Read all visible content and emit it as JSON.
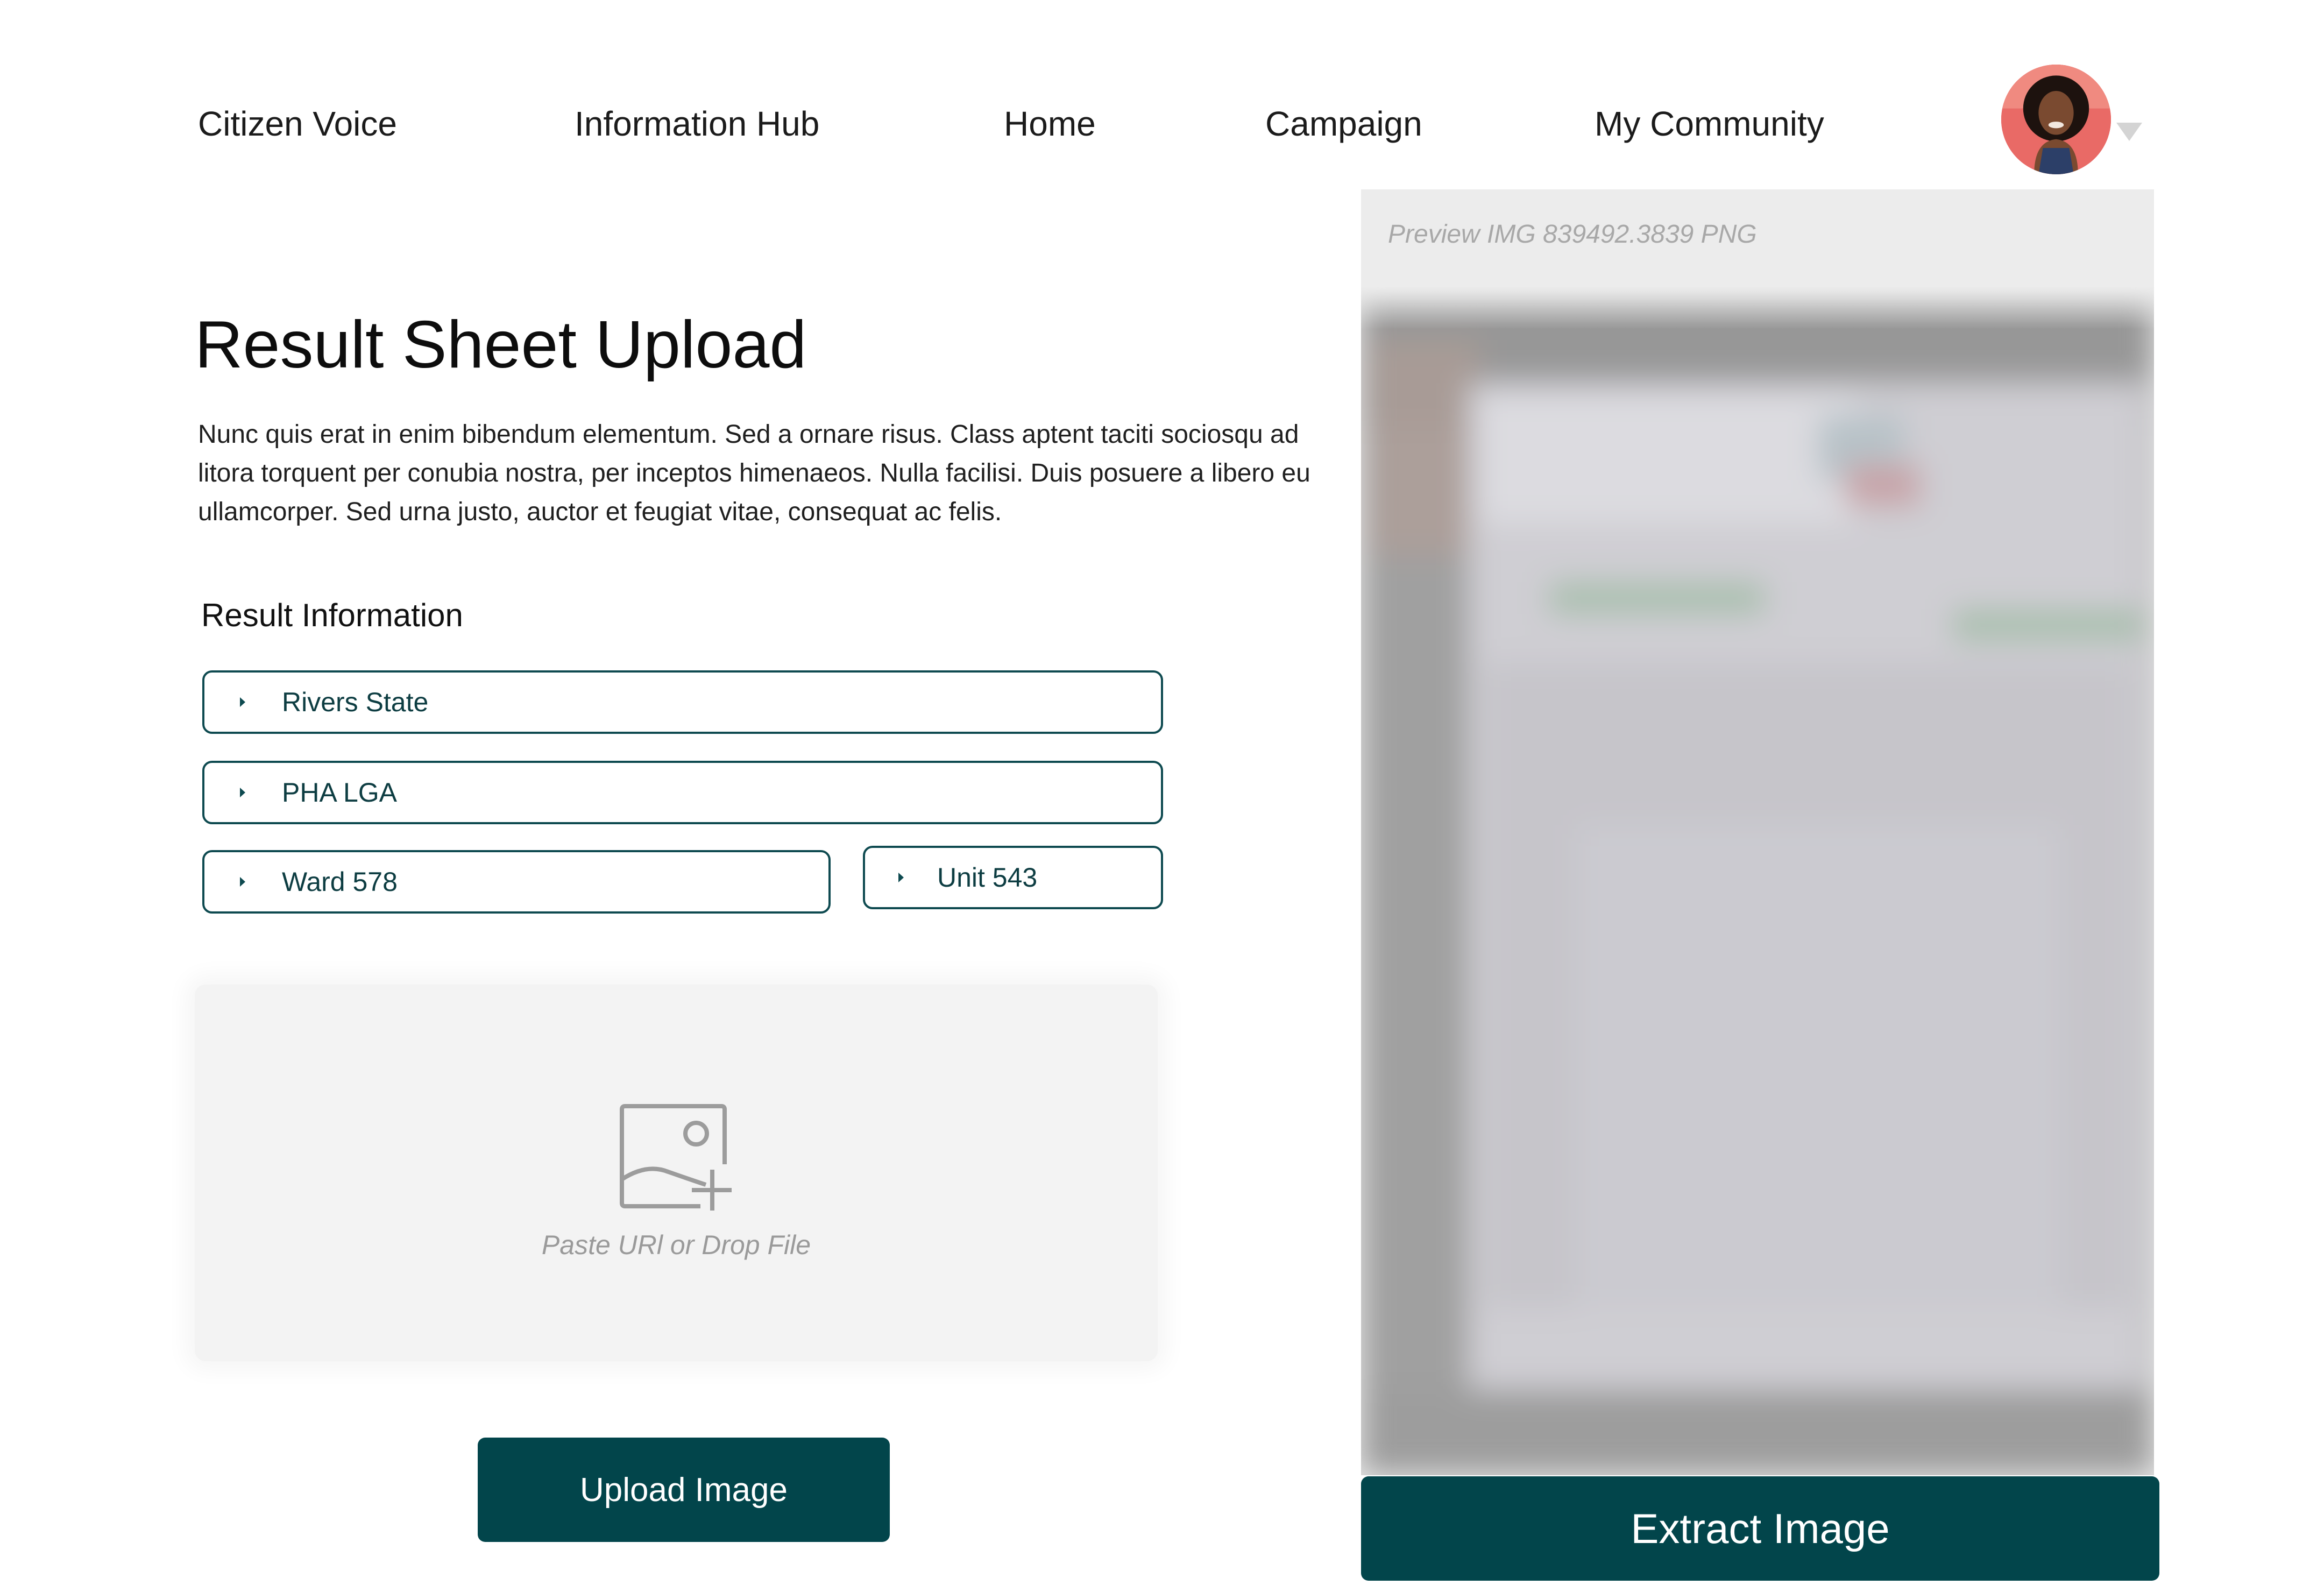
{
  "nav": {
    "items": [
      {
        "label": "Citizen Voice"
      },
      {
        "label": "Information Hub"
      },
      {
        "label": "Home"
      },
      {
        "label": "Campaign"
      },
      {
        "label": "My Community"
      }
    ],
    "avatar_icon": "user-avatar",
    "menu_icon": "caret-down-icon"
  },
  "main": {
    "title": "Result Sheet Upload",
    "description": "Nunc quis erat in enim bibendum elementum. Sed a ornare risus. Class aptent taciti sociosqu ad litora torquent per conubia nostra, per inceptos himenaeos. Nulla facilisi. Duis posuere a libero eu ullamcorper. Sed urna justo, auctor et feugiat vitae, consequat ac felis.",
    "section_label": "Result Information",
    "fields": {
      "state": "Rivers State",
      "lga": "PHA LGA",
      "ward": "Ward 578",
      "unit": "Unit 543"
    },
    "dropzone": {
      "icon": "image-add-icon",
      "text": "Paste URl or Drop File"
    },
    "upload_button": "Upload Image"
  },
  "preview": {
    "filename": "Preview IMG 839492.3839 PNG",
    "extract_button": "Extract Image"
  },
  "colors": {
    "accent": "#02454b",
    "field_border": "#0e4a50",
    "preview_bg": "#ececec",
    "dropzone_bg": "#f3f3f3"
  }
}
